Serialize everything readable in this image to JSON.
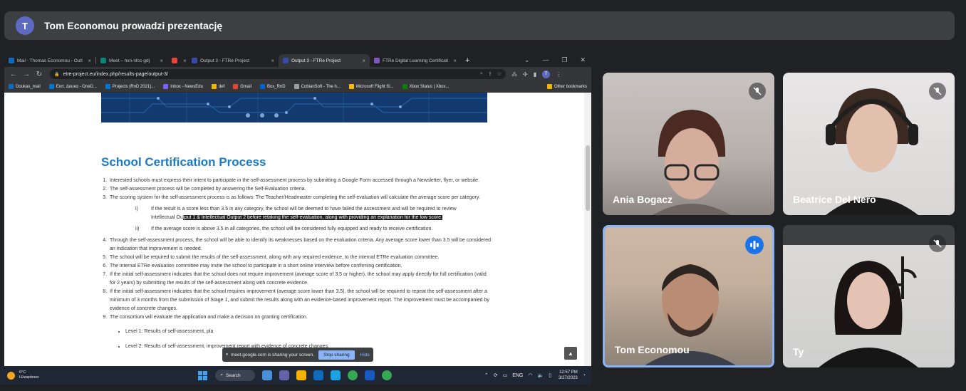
{
  "meet": {
    "banner_text": "Tom Economou prowadzi prezentację",
    "presenter_initial": "T"
  },
  "browser": {
    "tabs": [
      {
        "title": "Mail - Thomas Economou - Outl",
        "color": "#0f6cbd"
      },
      {
        "title": "Meet – hxn-nfcc-gdj",
        "color": "#00897b"
      },
      {
        "title": "",
        "color": "#ea4335"
      },
      {
        "title": "Output 3 - FTRe Project",
        "color": "#3949ab"
      },
      {
        "title": "Output 3 - FTRe Project",
        "color": "#3949ab",
        "active": true
      },
      {
        "title": "FTRe Digital Learning Certificati",
        "color": "#7e57c2"
      }
    ],
    "new_tab": "+",
    "url": "etre-project.eu/index.php/results-page/output-3/",
    "bookmarks": [
      {
        "label": "Doukas_mail",
        "color": "#0f6cbd"
      },
      {
        "label": "Εκπ. Δουκα - OneD...",
        "color": "#0078d4"
      },
      {
        "label": "Projects (RnD 2021)...",
        "color": "#0078d4"
      },
      {
        "label": "Inbox - NewsEdu",
        "color": "#7b61ff"
      },
      {
        "label": "def",
        "color": "#f4b400"
      },
      {
        "label": "Gmail",
        "color": "#ea4335"
      },
      {
        "label": "Box_RnD",
        "color": "#0061d5"
      },
      {
        "label": "CobianSoft - The h...",
        "color": "#9e9e9e"
      },
      {
        "label": "Microsoft Flight Si...",
        "color": "#fbbc04"
      },
      {
        "label": "Xbox Status | Xbox...",
        "color": "#107c10"
      }
    ],
    "other_bookmarks": "Other bookmarks",
    "profile_initial": "T"
  },
  "page": {
    "title": "School Certification Process",
    "items": [
      "Interested schools must express their intent to participate in the self-assessment process by submitting a Google Form accessed through a Newsletter, flyer, or website.",
      "The self-assessment process will be completed by answering the Self-Evaluation criteria.",
      "The scoring system for the self-assessment process is as follows: The Teacher/Headmaster completing the self-evaluation will calculate the average score per category.",
      "Through the self-assessment process, the school will be able to identify its weaknesses based on the evaluation criteria. Any average score lower than 3.5 will be considered an indication that improvement is needed.",
      "The school will be required to submit the results of the self-assessment, along with any required evidence, to the internal ETRe evaluation committee.",
      "The internal ETRe evaluation committee may invite the school to participate in a short online interview before confirming certification.",
      "If the initial self-assessment indicates that the school does not require improvement (average score of 3.5 or higher), the school may apply directly for full certification (valid for 2 years) by submitting the results of the self-assessment along with concrete evidence.",
      "If the initial self-assessment indicates that the school requires improvement (average score lower than 3.5), the school will be required to repeat the self-assessment after a minimum of 3 months from the submission of Stage 1, and submit the results along with an evidence-based improvement report. The improvement must be accompanied by evidence of concrete changes.",
      "The consortium will evaluate the application and make a decision on granting certification."
    ],
    "sub_i_num": "i)",
    "sub_i_line1": "If the result is a score less than 3.5 in any category, the school will be deemed to have failed the assessment and will be required to review",
    "sub_i_line2_plain": "Intellectual Ou",
    "sub_i_line2_highlight": "tput 1 & Intellectual Output 2 before retaking the self-evaluation, along with providing an explanation for the low score.",
    "sub_ii_num": "ii)",
    "sub_ii_text": "If the average score is above 3.5 in all categories, the school will be considered fully equipped and ready to receive certification.",
    "bullets": [
      "Level 1: Results of self-assessment, pla",
      "Level 2: Results of self-assessment, improvement report with evidence of concrete changes."
    ],
    "scroll_top_glyph": "▲"
  },
  "sharebar": {
    "text": "meet.google.com is sharing your screen.",
    "stop": "Stop sharing",
    "hide": "Hide"
  },
  "taskbar": {
    "temp": "6°C",
    "weather": "Ηλιοφάνεια",
    "search": "Search",
    "lang": "ENG",
    "time": "12:57 PM",
    "date": "3/27/2023"
  },
  "participants": [
    {
      "name": "Ania Bogacz",
      "muted": true
    },
    {
      "name": "Beatrice Del Nero",
      "muted": true
    },
    {
      "name": "Tom Economou",
      "speaking": true
    },
    {
      "name": "Ty",
      "muted": true
    }
  ]
}
